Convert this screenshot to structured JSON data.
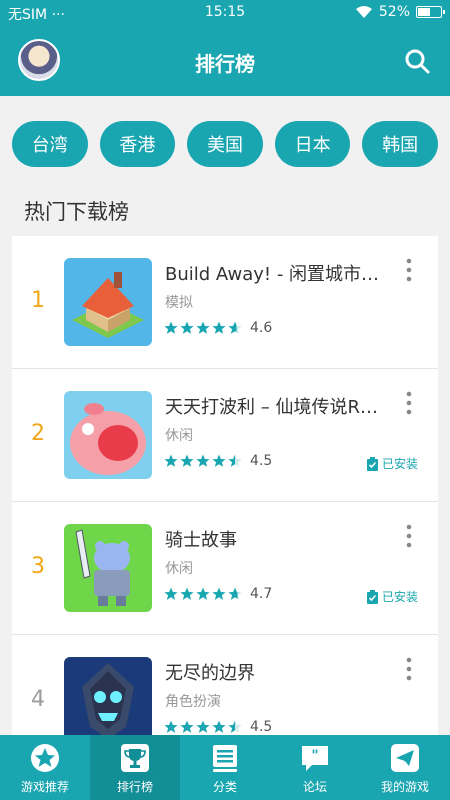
{
  "status_bar": {
    "carrier": "无SIM",
    "dots": "···",
    "time": "15:15",
    "battery": "52%",
    "battery_level": 0.52
  },
  "header": {
    "title": "排行榜"
  },
  "regions": [
    "台湾",
    "香港",
    "美国",
    "日本",
    "韩国"
  ],
  "section_title": "热门下载榜",
  "apps": [
    {
      "rank": "1",
      "name": " Build Away! - 闲置城市…",
      "category": "模拟",
      "rating": "4.6",
      "stars": 4.6,
      "installed": "",
      "rank_color": "#f0a818"
    },
    {
      "rank": "2",
      "name": "天天打波利 – 仙境传说R…",
      "category": "休闲",
      "rating": "4.5",
      "stars": 4.5,
      "installed": "已安装",
      "rank_color": "#f0a818"
    },
    {
      "rank": "3",
      "name": "骑士故事",
      "category": "休闲",
      "rating": "4.7",
      "stars": 4.7,
      "installed": "已安装",
      "rank_color": "#f0a818"
    },
    {
      "rank": "4",
      "name": "无尽的边界",
      "category": "角色扮演",
      "rating": "4.5",
      "stars": 4.5,
      "installed": "",
      "rank_color": "#9c9c9c"
    }
  ],
  "tabs": [
    {
      "label": "游戏推荐",
      "icon": "star-icon"
    },
    {
      "label": "排行榜",
      "icon": "trophy-icon",
      "active": true
    },
    {
      "label": "分类",
      "icon": "category-icon"
    },
    {
      "label": "论坛",
      "icon": "forum-icon"
    },
    {
      "label": "我的游戏",
      "icon": "paper-plane-icon"
    }
  ],
  "colors": {
    "accent": "#1aa6b0",
    "accent_dark": "#128e97",
    "rank_top": "#f0a818",
    "rank_other": "#9c9c9c"
  }
}
